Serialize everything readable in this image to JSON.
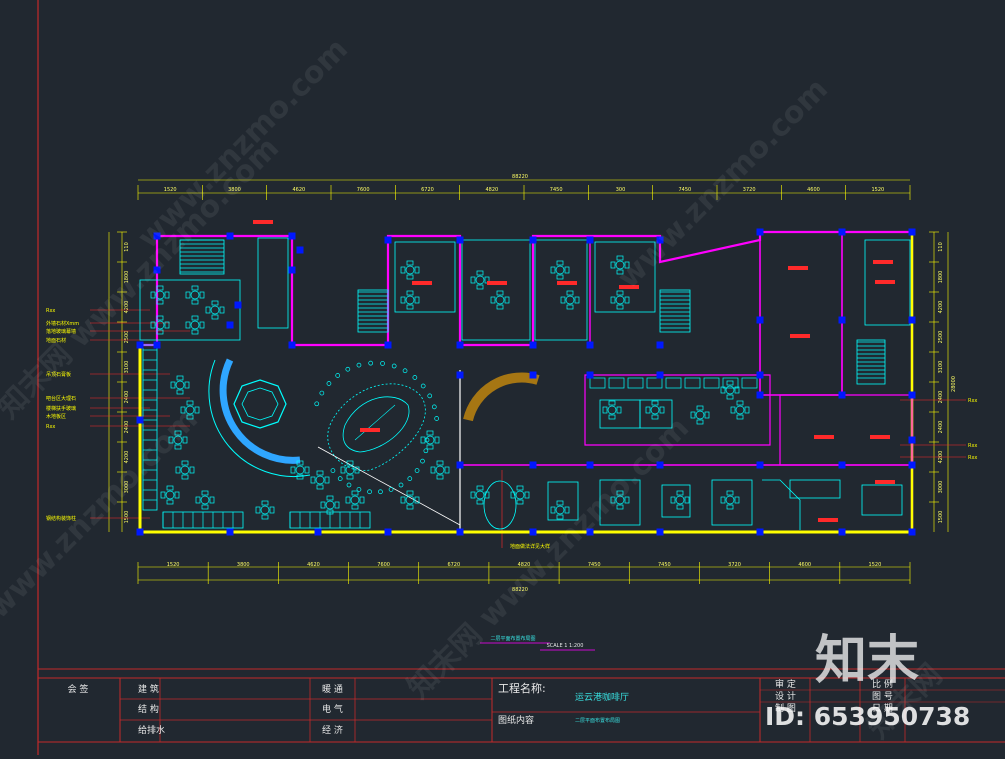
{
  "drawing": {
    "title_overall_dim": "88220",
    "top_dims": [
      "1520",
      "3800",
      "4620",
      "7600",
      "6720",
      "4820",
      "7450",
      "300",
      "7450",
      "3720",
      "4600",
      "1520"
    ],
    "bottom_dims": [
      "1520",
      "3800",
      "4620",
      "7600",
      "6720",
      "4820",
      "7450",
      "7450",
      "3720",
      "4600",
      "1520"
    ],
    "bottom_overall_dim": "88220",
    "left_dims": [
      "110",
      "1800",
      "4200",
      "2500",
      "3100",
      "2400",
      "2400",
      "4200",
      "3000",
      "1500"
    ],
    "right_dims": [
      "110",
      "1800",
      "4200",
      "2500",
      "3100",
      "2400",
      "2400",
      "4200",
      "3000",
      "1500"
    ],
    "right_overall_dim": "28000",
    "plan_caption": "二层平面布置布局图",
    "scale_text": "SCALE 1   1:200",
    "left_notes": [
      "Rxx",
      "外墙石材Xmm",
      "落地玻璃幕墙",
      "地面石材",
      "吊顶石膏板",
      "吧台区大理石",
      "楼梯扶手玻璃",
      "木地板区",
      "Rxx",
      "钢结构装饰柱"
    ],
    "right_notes": [
      "Rxx",
      "Rxx",
      "Rxx"
    ],
    "center_note": "地面做法详见大样"
  },
  "title_block": {
    "approve_label": "会 签",
    "rows_left": [
      "建 筑",
      "结 构",
      "给排水"
    ],
    "rows_mid": [
      "暖 通",
      "电 气",
      "经 济"
    ],
    "project_name_label": "工程名称:",
    "project_name": "运云港咖啡厅",
    "drawing_content_label": "图纸内容",
    "drawing_content": "二层平面布置布局图",
    "right_rows": [
      "审 定",
      "设 计",
      "制 图"
    ],
    "right_rows_b": [
      "比 例",
      "图 号",
      "日 期"
    ]
  },
  "watermark": {
    "logo": "知末",
    "id_text": "ID: 653950738",
    "diagonal": [
      "www.znzmo.com",
      "知末网 www.znzmo.com",
      "www.znzmo.com",
      "知末网 www.znzmo.com",
      "www.znzmo.com",
      "知末网"
    ]
  },
  "colors": {
    "background": "#212830",
    "wall": "#ff00ff",
    "column": "#0000ff",
    "furniture": "#00ffff",
    "dimension": "#ffff00",
    "frame": "#cc2b2b",
    "room_tag": "#ff2a2a"
  }
}
